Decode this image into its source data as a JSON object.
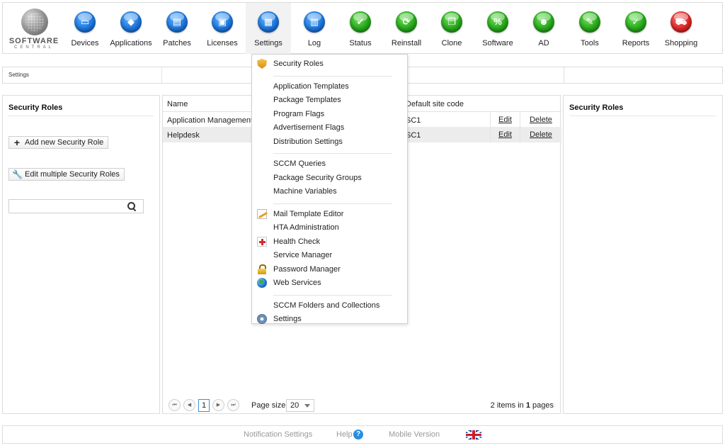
{
  "logo": {
    "name": "SOFTWARE",
    "sub": "CENTRAL"
  },
  "nav": [
    {
      "label": "Devices",
      "icon": "monitor-icon",
      "color": "blue",
      "glyph": "▭"
    },
    {
      "label": "Applications",
      "icon": "applications-icon",
      "color": "blue",
      "glyph": "◆"
    },
    {
      "label": "Patches",
      "icon": "patches-icon",
      "color": "blue",
      "glyph": "▤"
    },
    {
      "label": "Licenses",
      "icon": "licenses-icon",
      "color": "blue",
      "glyph": "▣"
    },
    {
      "label": "Settings",
      "icon": "settings-icon",
      "color": "blue",
      "glyph": "▦",
      "active": true
    },
    {
      "label": "Log",
      "icon": "log-icon",
      "color": "blue",
      "glyph": "▥"
    },
    {
      "label": "Status",
      "icon": "status-icon",
      "color": "green",
      "glyph": "✔"
    },
    {
      "label": "Reinstall",
      "icon": "reinstall-icon",
      "color": "green",
      "glyph": "⟳"
    },
    {
      "label": "Clone",
      "icon": "clone-icon",
      "color": "green",
      "glyph": "❐"
    },
    {
      "label": "Software",
      "icon": "software-icon",
      "color": "green",
      "glyph": "%"
    },
    {
      "label": "AD",
      "icon": "ad-users-icon",
      "color": "green",
      "glyph": "☻"
    },
    {
      "label": "Tools",
      "icon": "tools-icon",
      "color": "green",
      "glyph": "✎"
    },
    {
      "label": "Reports",
      "icon": "reports-icon",
      "color": "green",
      "glyph": "✓"
    },
    {
      "label": "Shopping",
      "icon": "shopping-cart-icon",
      "color": "red",
      "glyph": "⛟"
    }
  ],
  "breadcrumb": "Settings",
  "left_panel": {
    "title": "Security Roles",
    "add_button": "Add new Security Role",
    "edit_multiple_button": "Edit multiple Security Roles",
    "search_value": "",
    "search_placeholder": ""
  },
  "grid": {
    "columns": {
      "name": "Name",
      "site": "Default site code"
    },
    "rows": [
      {
        "name": "Application Management",
        "site": "SC1",
        "edit": "Edit",
        "delete": "Delete"
      },
      {
        "name": "Helpdesk",
        "site": "SC1",
        "edit": "Edit",
        "delete": "Delete"
      }
    ],
    "pager": {
      "current_page": "1",
      "page_size_label": "Page size:",
      "page_size": "20",
      "items": "2",
      "items_text": "items in",
      "pages": "1",
      "pages_text": "pages"
    }
  },
  "right_panel": {
    "title": "Security Roles"
  },
  "menu": {
    "groups": [
      [
        {
          "label": "Security Roles",
          "icon": "shield-icon"
        }
      ],
      [
        {
          "label": "Application Templates"
        },
        {
          "label": "Package Templates"
        },
        {
          "label": "Program Flags"
        },
        {
          "label": "Advertisement Flags"
        },
        {
          "label": "Distribution Settings"
        }
      ],
      [
        {
          "label": "SCCM Queries"
        },
        {
          "label": "Package Security Groups"
        },
        {
          "label": "Machine Variables"
        }
      ],
      [
        {
          "label": "Mail Template Editor",
          "icon": "pencil-doc-icon"
        },
        {
          "label": "HTA Administration"
        },
        {
          "label": "Health Check",
          "icon": "health-icon"
        },
        {
          "label": "Service Manager"
        },
        {
          "label": "Password Manager",
          "icon": "lock-icon"
        },
        {
          "label": "Web Services",
          "icon": "globe-icon"
        }
      ],
      [
        {
          "label": "SCCM Folders and Collections"
        },
        {
          "label": "Settings",
          "icon": "gear-icon"
        }
      ]
    ]
  },
  "footer": {
    "notification_settings": "Notification Settings",
    "help": "Help",
    "help_glyph": "?",
    "mobile_version": "Mobile Version"
  }
}
